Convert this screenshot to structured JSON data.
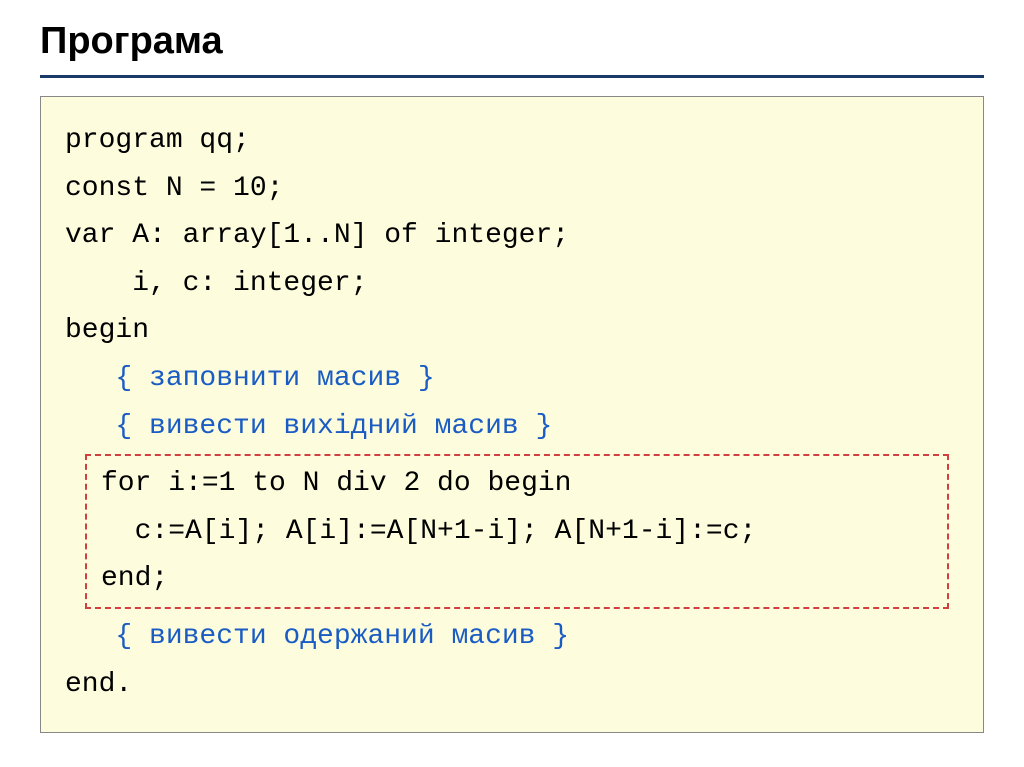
{
  "title": "Програма",
  "code": {
    "line1": "program qq;",
    "line2": "const N = 10;",
    "line3": "var A: array[1..N] of integer;",
    "line4": "    i, c: integer;",
    "line5": "begin",
    "comment1": "   { заповнити масив }",
    "comment2": "   { вивести вихідний масив }",
    "box_line1": "for i:=1 to N div 2 do begin",
    "box_line2": "  c:=A[i]; A[i]:=A[N+1-i]; A[N+1-i]:=c;",
    "box_line3": "end;",
    "comment3": "   { вивести одержаний масив }",
    "line_end": "end."
  }
}
